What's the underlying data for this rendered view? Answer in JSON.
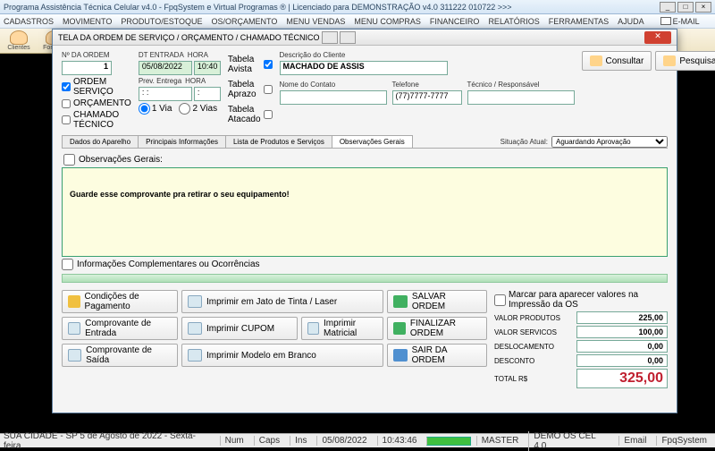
{
  "window": {
    "title": "Programa Assistência Técnica Celular v4.0 - FpqSystem e Virtual Programas ® | Licenciado para  DEMONSTRAÇÃO v4.0 311222 010722 >>>"
  },
  "menus": [
    "CADASTROS",
    "MOVIMENTO",
    "PRODUTO/ESTOQUE",
    "OS/ORÇAMENTO",
    "MENU VENDAS",
    "MENU COMPRAS",
    "FINANCEIRO",
    "RELATÓRIOS",
    "FERRAMENTAS",
    "AJUDA"
  ],
  "email_label": "E-MAIL",
  "tool_labels": {
    "clientes": "Clientes",
    "fornece": "Fornece"
  },
  "dialog": {
    "title": "TELA DA ORDEM DE SERVIÇO / ORÇAMENTO / CHAMADO TÉCNICO",
    "n_ordem_lbl": "Nº DA ORDEM",
    "n_ordem": "1",
    "chk_os": "ORDEM SERVIÇO",
    "chk_orc": "ORÇAMENTO",
    "chk_ct": "CHAMADO TÉCNICO",
    "dt_entrada_lbl": "DT ENTRADA",
    "hora_lbl": "HORA",
    "dt_entrada": "05/08/2022",
    "hora": "10:40",
    "prev_entrega_lbl": "Prev. Entrega",
    "prev_entrega": ":  :",
    "prev_hora": ":",
    "via1": "1 Via",
    "via2": "2 Vias",
    "tbl_avista": "Tabela Avista",
    "tbl_aprazo": "Tabela Aprazo",
    "tbl_atacado": "Tabela Atacado",
    "desc_cliente_lbl": "Descrição do Cliente",
    "desc_cliente": "MACHADO DE ASSIS",
    "nome_contato_lbl": "Nome do Contato",
    "nome_contato": "",
    "telefone_lbl": "Telefone",
    "telefone": "(77)7777-7777",
    "tecnico_lbl": "Técnico / Responsável",
    "tecnico": "",
    "btn_consultar": "Consultar",
    "btn_pesquisar": "Pesquisar",
    "tabs": [
      "Dados do Aparelho",
      "Principais Informações",
      "Lista de Produtos e Serviços",
      "Observações Gerais"
    ],
    "situacao_lbl": "Situação Atual:",
    "situacao": "Aguardando Aprovação",
    "obs_head": "Observações Gerais:",
    "obs_text": "Guarde esse comprovante pra retirar o seu equipamento!",
    "obs_foot": "Informações Complementares ou Ocorrências",
    "btns": {
      "cond_pag": "Condições de Pagamento",
      "jato": "Imprimir em Jato de Tinta / Laser",
      "salvar": "SALVAR ORDEM",
      "comp_ent": "Comprovante de Entrada",
      "cupom": "Imprimir CUPOM",
      "matricial": "Imprimir Matricial",
      "finalizar": "FINALIZAR ORDEM",
      "comp_sai": "Comprovante de Saída",
      "modelo": "Imprimir Modelo em Branco",
      "sair": "SAIR DA ORDEM"
    },
    "mark_print": "Marcar para aparecer valores na Impressão da OS",
    "totals": {
      "prod_lbl": "VALOR PRODUTOS",
      "prod": "225,00",
      "serv_lbl": "VALOR SERVICOS",
      "serv": "100,00",
      "desl_lbl": "DESLOCAMENTO",
      "desl": "0,00",
      "desc_lbl": "DESCONTO",
      "desc": "0,00",
      "total_lbl": "TOTAL R$",
      "total": "325,00"
    }
  },
  "statusbar": {
    "loc": "SUA CIDADE - SP  5 de Agosto de 2022 - Sexta-feira",
    "num": "Num",
    "caps": "Caps",
    "ins": "Ins",
    "date": "05/08/2022",
    "time": "10:43:46",
    "user": "MASTER",
    "os": "DEMO OS CEL 4.0",
    "email": "Email",
    "fpq": "FpqSystem"
  }
}
